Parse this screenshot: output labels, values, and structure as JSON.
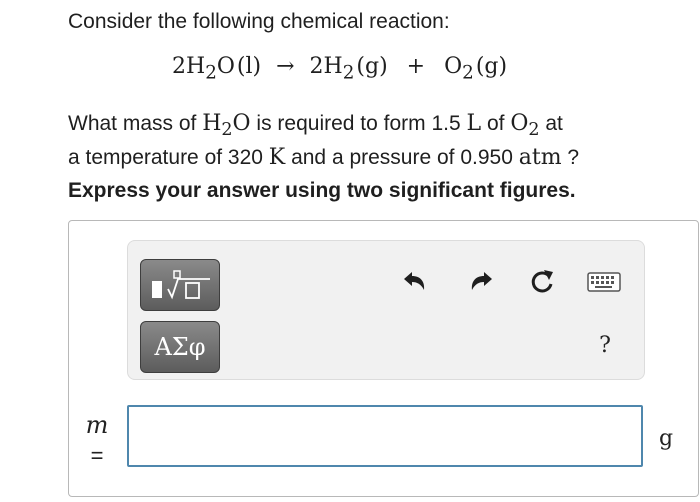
{
  "question": {
    "intro": "Consider the following chemical reaction:",
    "equation": {
      "reactant_coeff": "2H",
      "reactant_sub": "2",
      "reactant_rest": "O",
      "reactant_phase": "(l)",
      "arrow": "→",
      "product1_coeff": "2H",
      "product1_sub": "2",
      "product1_phase": "(g)",
      "plus": "+",
      "product2": "O",
      "product2_sub": "2",
      "product2_phase": "(g)"
    },
    "line1": {
      "t1": "What mass of ",
      "m1": "H",
      "m1_sub": "2",
      "m1b": "O",
      "t2": " is required to form 1.5 ",
      "m2": "L",
      "t3": " of ",
      "m3": "O",
      "m3_sub": "2",
      "t4": " at"
    },
    "line2": {
      "t1": "a temperature of 320 ",
      "m1": "K",
      "t2": " and a pressure of 0.950 ",
      "m2": "atm",
      "t3": " ?"
    },
    "instruction": "Express your answer using two significant figures."
  },
  "toolbar": {
    "symbols_label": "ΑΣφ",
    "help_label": "?",
    "icons": [
      "templates-icon",
      "undo-icon",
      "redo-icon",
      "reset-icon",
      "keyboard-icon"
    ]
  },
  "answer": {
    "variable": "m",
    "equals": "=",
    "value": "",
    "unit": "g"
  },
  "colors": {
    "input_border": "#4f87ad",
    "toolbar_button": "#6f6f6f"
  }
}
